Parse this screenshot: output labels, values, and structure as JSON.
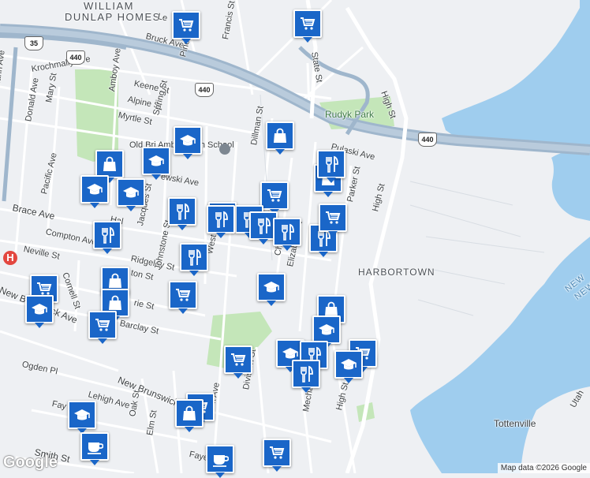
{
  "colors": {
    "water": "#9fcdee",
    "park": "#c4e6b9",
    "land": "#eef0f3",
    "highway": "#9fb6cc",
    "marker": "#1a66c8",
    "hospital": "#e3473f"
  },
  "labels": {
    "neighborhood_top_1": "WILLIAM",
    "neighborhood_top_2": "DUNLAP HOMES",
    "harbortown": "HARBORTOWN",
    "rudyk_park": "Rudyk Park",
    "tottenville": "Tottenville",
    "new_area": "NEW"
  },
  "route_shields": {
    "i35": "35",
    "r440_a": "440",
    "r440_b": "440",
    "r440_c": "440"
  },
  "streets": {
    "lee_st": "Le",
    "bruck_ave": "Bruck Ave",
    "francis_st": "Francis St",
    "pine_st": "Pine St",
    "state_st": "State St",
    "krochmally_ave": "Krochmally Ave",
    "keene_st": "Keene St",
    "alpine_st": "Alpine St",
    "myrtle_st": "Myrtle St",
    "spring_st": "Spring St",
    "amboy_ave": "Amboy Ave",
    "donald_ave": "Donald Ave",
    "mary_st": "Mary St",
    "mann_ave": "mann Ave",
    "high_st_n": "High St",
    "dillman_st": "Dillman St",
    "pulaski_ave": "Pulaski Ave",
    "old_school": "Old Bri Amboy High School",
    "kewski_ave": "ewski Ave",
    "pacific_ave": "Pacific Ave",
    "brace_ave": "Brace Ave",
    "compton_ave": "Compton Ave",
    "neville_st": "Neville St",
    "hall_ave": "Hal",
    "jacques_st": "Jacques St",
    "west_st": "West St",
    "ridgeley_st": "Ridgeley St",
    "ton_st": "ton St",
    "johnstone_st": "Johnstone St",
    "cornell_st": "Cornell St",
    "charles_st": "Chai",
    "elizabeth_st": "Elizabeth St",
    "parker_st": "Parker St",
    "high_st_mid": "High St",
    "rie_st": "rie St",
    "barclay_st": "Barclay St",
    "new_brunswick_ave": "New Brunswick Ave",
    "new_brunswick_ave_2": "New Brunswick Ave",
    "ogden_pl": "Ogden Pl",
    "division_st": "Division St",
    "mechanic_st": "Mechanic St",
    "high_st_s": "High St",
    "park_ave": "Park Ave",
    "oak_st": "Oak St",
    "elm_st": "Elm St",
    "smith_st": "Smith St",
    "fay_1": "Fay",
    "fay_2": "Faye",
    "lehigh_ave": "Lehigh Ave",
    "utah": "Utah",
    "new_ave_fragment": "NEW"
  },
  "markers": [
    {
      "type": "shopping-cart"
    },
    {
      "type": "shopping-cart"
    },
    {
      "type": "shopping-bag"
    },
    {
      "type": "school"
    },
    {
      "type": "school"
    },
    {
      "type": "shopping-bag"
    },
    {
      "type": "school"
    },
    {
      "type": "school"
    },
    {
      "type": "restaurant"
    },
    {
      "type": "shopping-cart"
    },
    {
      "type": "restaurant"
    },
    {
      "type": "restaurant"
    },
    {
      "type": "restaurant"
    },
    {
      "type": "restaurant"
    },
    {
      "type": "restaurant"
    },
    {
      "type": "shopping-bag"
    },
    {
      "type": "shopping-cart"
    },
    {
      "type": "restaurant"
    },
    {
      "type": "restaurant"
    },
    {
      "type": "restaurant"
    },
    {
      "type": "restaurant"
    },
    {
      "type": "shopping-cart"
    },
    {
      "type": "shopping-bag"
    },
    {
      "type": "shopping-bag"
    },
    {
      "type": "school"
    },
    {
      "type": "shopping-cart"
    },
    {
      "type": "school"
    },
    {
      "type": "shopping-cart"
    },
    {
      "type": "shopping-bag"
    },
    {
      "type": "school"
    },
    {
      "type": "shopping-cart"
    },
    {
      "type": "school"
    },
    {
      "type": "restaurant"
    },
    {
      "type": "shopping-cart"
    },
    {
      "type": "school"
    },
    {
      "type": "restaurant"
    },
    {
      "type": "shopping-cart"
    },
    {
      "type": "shopping-bag"
    },
    {
      "type": "school"
    },
    {
      "type": "cafe"
    },
    {
      "type": "shopping-cart"
    },
    {
      "type": "cafe"
    }
  ],
  "footer": {
    "google": "Google",
    "attribution": "Map data ©2026 Google"
  }
}
